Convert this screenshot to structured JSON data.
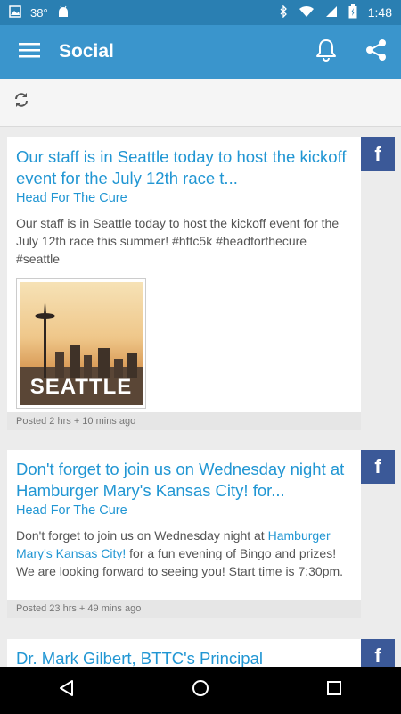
{
  "status_bar": {
    "temperature": "38°",
    "time": "1:48",
    "icons": [
      "image-icon",
      "android-icon",
      "bluetooth-icon",
      "wifi-icon",
      "signal-icon",
      "battery-icon"
    ]
  },
  "app_bar": {
    "title": "Social",
    "icons": [
      "menu-icon",
      "bell-icon",
      "share-icon"
    ],
    "color": "#3a95cc"
  },
  "toolbar": {
    "icons": [
      "refresh-icon"
    ]
  },
  "posts": [
    {
      "title": "Our staff is in Seattle today to host the kickoff event for the July 12th race t...",
      "source": "Head For The Cure",
      "body": "Our staff is in Seattle today to host the kickoff event for the July 12th race this summer! #hftc5k #headforthecure #seattle",
      "image_text": "SEATTLE",
      "posted": "Posted 2 hrs + 10 mins ago",
      "network": "f"
    },
    {
      "title": "Don't forget to join us on Wednesday night at Hamburger Mary's Kansas City! for...",
      "source": "Head For The Cure",
      "body_before": "Don't forget to join us on Wednesday night at ",
      "body_link": "Hamburger Mary's Kansas City!",
      "body_after": " for a fun evening of Bingo and prizes! We are looking forward to seeing you! Start time is 7:30pm.",
      "posted": "Posted 23 hrs + 49 mins ago",
      "network": "f"
    },
    {
      "title": "Dr. Mark Gilbert, BTTC's Principal",
      "network": "f"
    }
  ],
  "nav_bar": {
    "icons": [
      "back-icon",
      "home-icon",
      "recents-icon"
    ]
  }
}
